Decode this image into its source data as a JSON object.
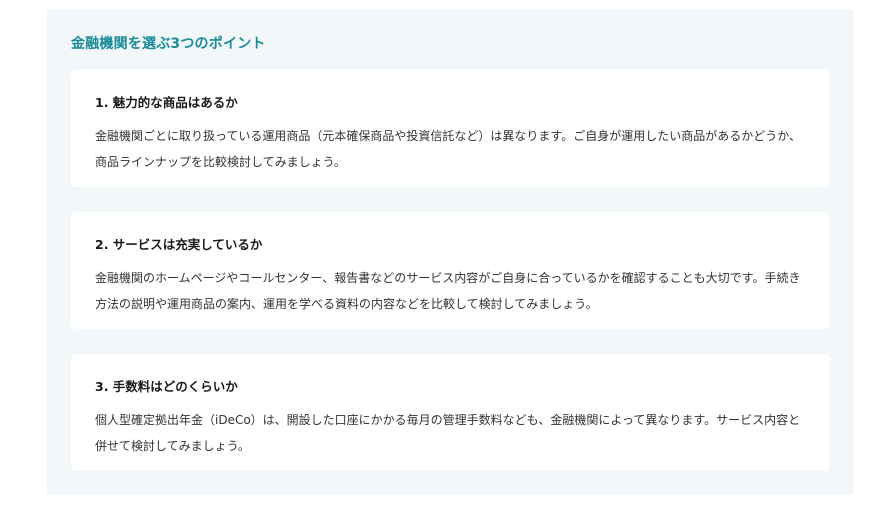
{
  "section": {
    "title": "金融機関を選ぶ3つのポイント"
  },
  "points": [
    {
      "title": "1. 魅力的な商品はあるか",
      "body": "金融機関ごとに取り扱っている運用商品（元本確保商品や投資信託など）は異なります。ご自身が運用したい商品があるかどうか、商品ラインナップを比較検討してみましょう。"
    },
    {
      "title": "2. サービスは充実しているか",
      "body": "金融機関のホームページやコールセンター、報告書などのサービス内容がご自身に合っているかを確認することも大切です。手続き方法の説明や運用商品の案内、運用を学べる資料の内容などを比較して検討してみましょう。"
    },
    {
      "title": "3. 手数料はどのくらいか",
      "body": "個人型確定拠出年金（iDeCo）は、開設した口座にかかる毎月の管理手数料なども、金融機関によって異なります。サービス内容と併せて検討してみましょう。"
    }
  ]
}
